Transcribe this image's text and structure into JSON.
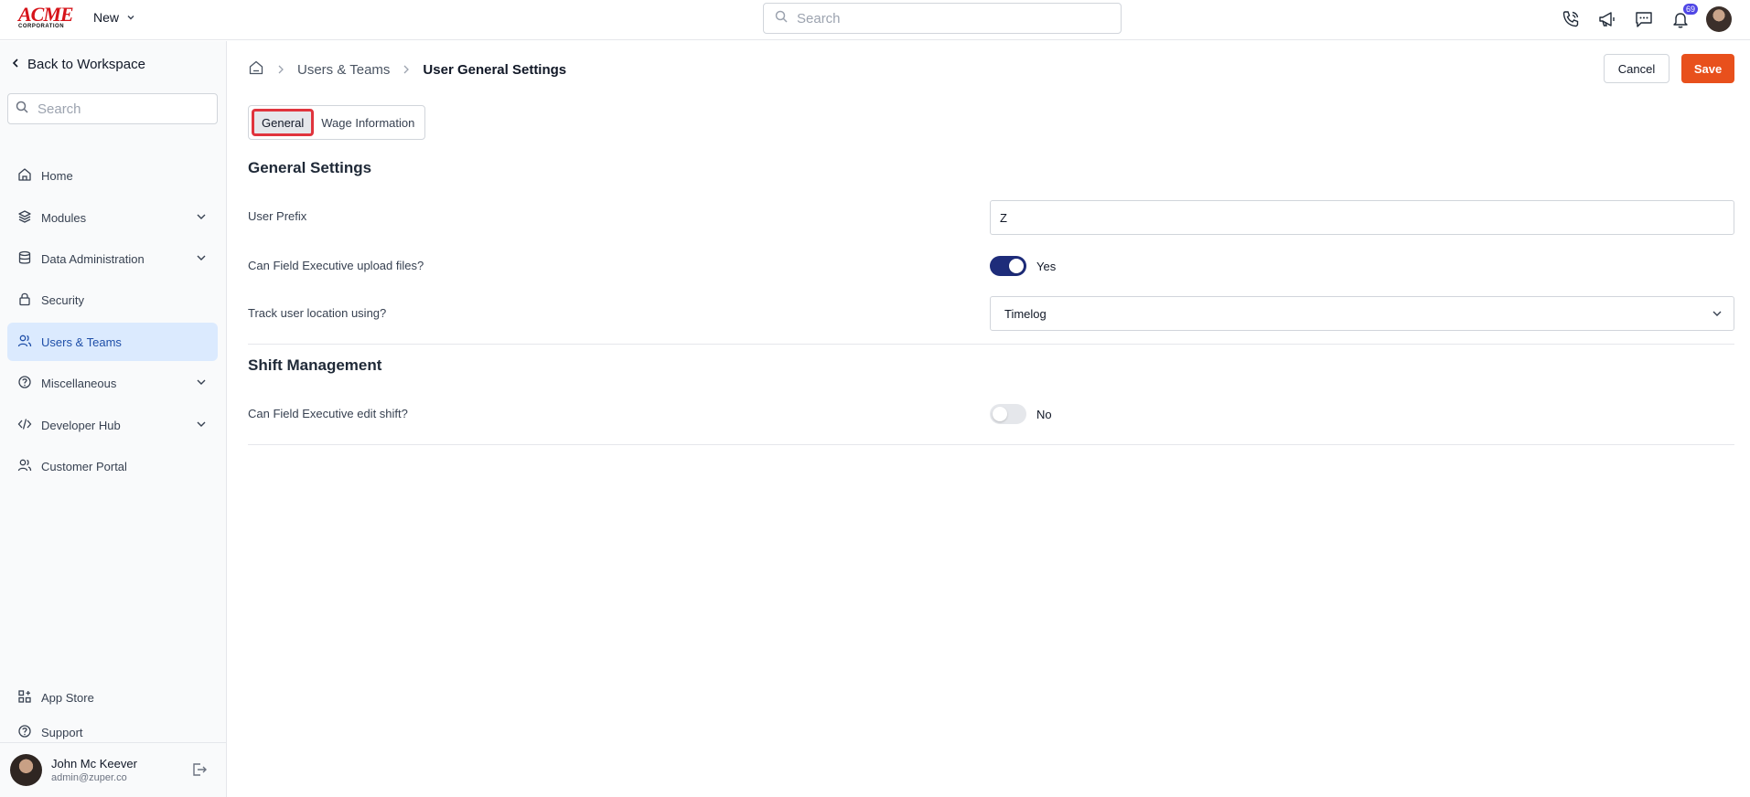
{
  "topbar": {
    "logo_word": "ACME",
    "logo_sub": "CORPORATION",
    "new_label": "New",
    "search_placeholder": "Search",
    "notification_count": "69",
    "icons": [
      "phone-icon",
      "megaphone-icon",
      "chat-icon",
      "bell-icon"
    ]
  },
  "sidebar": {
    "back_label": "Back to Workspace",
    "search_placeholder": "Search",
    "items": [
      {
        "label": "Home",
        "icon": "home-icon",
        "expandable": false
      },
      {
        "label": "Modules",
        "icon": "layers-icon",
        "expandable": true
      },
      {
        "label": "Data Administration",
        "icon": "database-icon",
        "expandable": true
      },
      {
        "label": "Security",
        "icon": "lock-icon",
        "expandable": false
      },
      {
        "label": "Users & Teams",
        "icon": "users-icon",
        "expandable": false,
        "active": true
      },
      {
        "label": "Miscellaneous",
        "icon": "help-circle-icon",
        "expandable": true
      },
      {
        "label": "Developer Hub",
        "icon": "code-icon",
        "expandable": true
      },
      {
        "label": "Customer Portal",
        "icon": "users-icon",
        "expandable": false
      }
    ],
    "bottom_items": [
      {
        "label": "App Store",
        "icon": "apps-icon"
      },
      {
        "label": "Support",
        "icon": "help-circle-icon"
      }
    ],
    "user": {
      "name": "John Mc Keever",
      "email": "admin@zuper.co"
    }
  },
  "main": {
    "breadcrumb": {
      "parent": "Users & Teams",
      "current": "User General Settings"
    },
    "cancel_label": "Cancel",
    "save_label": "Save",
    "tabs": [
      {
        "label": "General",
        "active": true
      },
      {
        "label": "Wage Information",
        "active": false
      }
    ],
    "general_settings": {
      "title": "General Settings",
      "user_prefix_label": "User Prefix",
      "user_prefix_value": "Z",
      "upload_label": "Can Field Executive upload files?",
      "upload_state": "Yes",
      "upload_on": true,
      "track_label": "Track user location using?",
      "track_value": "Timelog"
    },
    "shift_management": {
      "title": "Shift Management",
      "edit_shift_label": "Can Field Executive edit shift?",
      "edit_shift_state": "No",
      "edit_shift_on": false
    }
  },
  "colors": {
    "accent": "#e8501c",
    "toggle_on": "#1e2c7a",
    "active_nav": "#dbeafe",
    "tab_highlight": "#e0343d"
  }
}
